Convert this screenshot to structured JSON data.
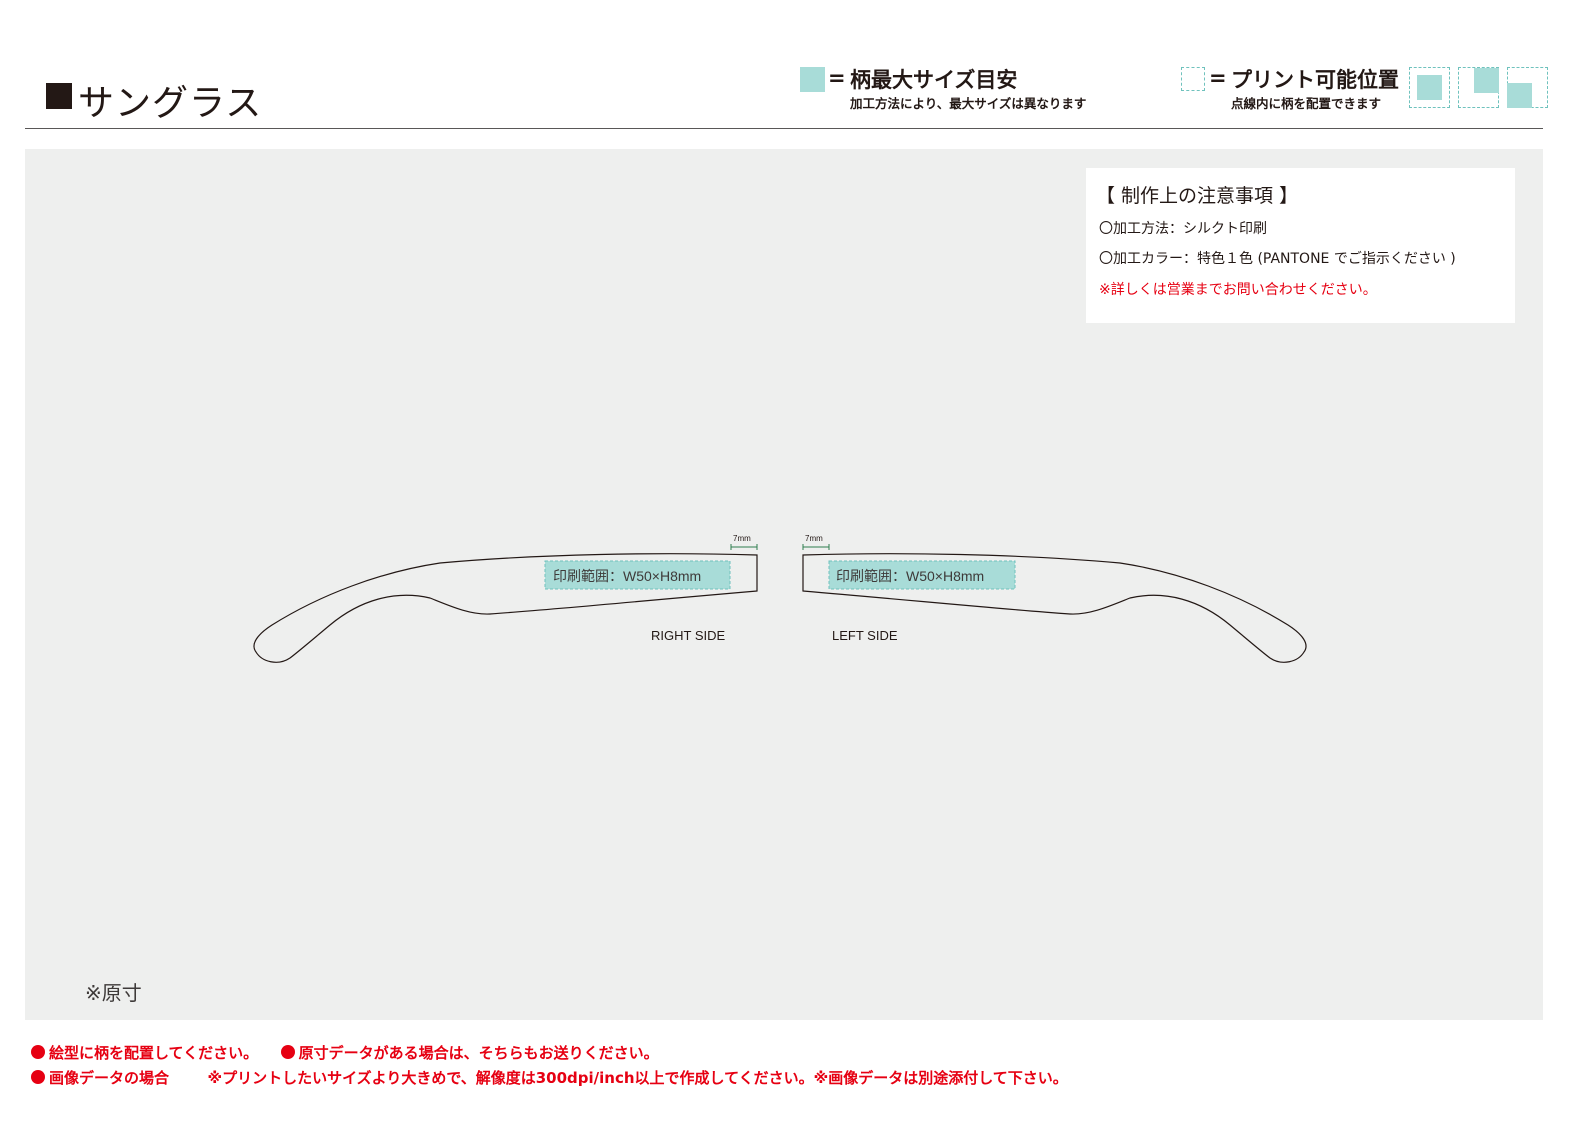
{
  "header": {
    "title": "サングラス",
    "legend_max_size": {
      "label": "柄最大サイズ目安",
      "note": "加工方法により、最大サイズは異なります"
    },
    "legend_print_position": {
      "label": "プリント可能位置",
      "note": "点線内に柄を配置できます"
    },
    "equals": "="
  },
  "notes": {
    "title": "【 制作上の注意事項 】",
    "method": "〇加工方法：シルクト印刷",
    "color": "〇加工カラー：特色１色 (PANTONE でご指示ください )",
    "warning": "※詳しくは営業までお問い合わせください。"
  },
  "diagram": {
    "right_label": "RIGHT SIDE",
    "left_label": "LEFT SIDE",
    "print_area_label": "印刷範囲：W50×H8mm",
    "dimension_label": "7mm"
  },
  "scale_note": "※原寸",
  "footer": {
    "line1_a": "絵型に柄を配置してください。",
    "line1_b": "原寸データがある場合は、そちらもお送りください。",
    "line2_a": "画像データの場合",
    "line2_b": "※プリントしたいサイズより大きめで、解像度は300dpi/inch以上で作成してください。※画像データは別途添付して下さい。"
  },
  "colors": {
    "max_size_fill": "#a8dcd8",
    "print_position_border": "#6fc2bd",
    "canvas_bg": "#eeefee",
    "warning_red": "#e60012",
    "dimension_green": "#2e7d4f"
  }
}
